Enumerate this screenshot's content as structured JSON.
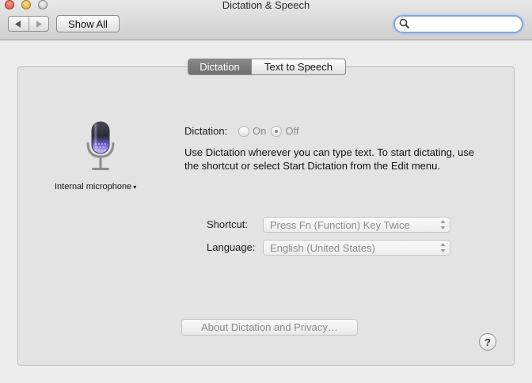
{
  "window": {
    "title": "Dictation & Speech"
  },
  "toolbar": {
    "back_icon": "back-arrow-icon",
    "forward_icon": "forward-arrow-icon",
    "show_all_label": "Show All",
    "search": {
      "value": "",
      "placeholder": ""
    }
  },
  "tabs": [
    {
      "label": "Dictation",
      "selected": true
    },
    {
      "label": "Text to Speech",
      "selected": false
    }
  ],
  "microphone": {
    "icon": "microphone-icon",
    "label": "Internal microphone",
    "dropdown_glyph": "▾"
  },
  "dictation": {
    "label": "Dictation:",
    "options": [
      {
        "label": "On",
        "checked": false
      },
      {
        "label": "Off",
        "checked": true
      }
    ],
    "description": "Use Dictation wherever you can type text. To start dictating, use the shortcut or select Start Dictation from the Edit menu."
  },
  "shortcut": {
    "label": "Shortcut:",
    "value": "Press Fn (Function) Key Twice"
  },
  "language": {
    "label": "Language:",
    "value": "English (United States)"
  },
  "about_button_label": "About Dictation and Privacy…",
  "help_button_label": "?",
  "colors": {
    "selected_tab": "#777777",
    "disabled_text": "#8a8a8a",
    "search_focus": "#7fa9e0"
  }
}
